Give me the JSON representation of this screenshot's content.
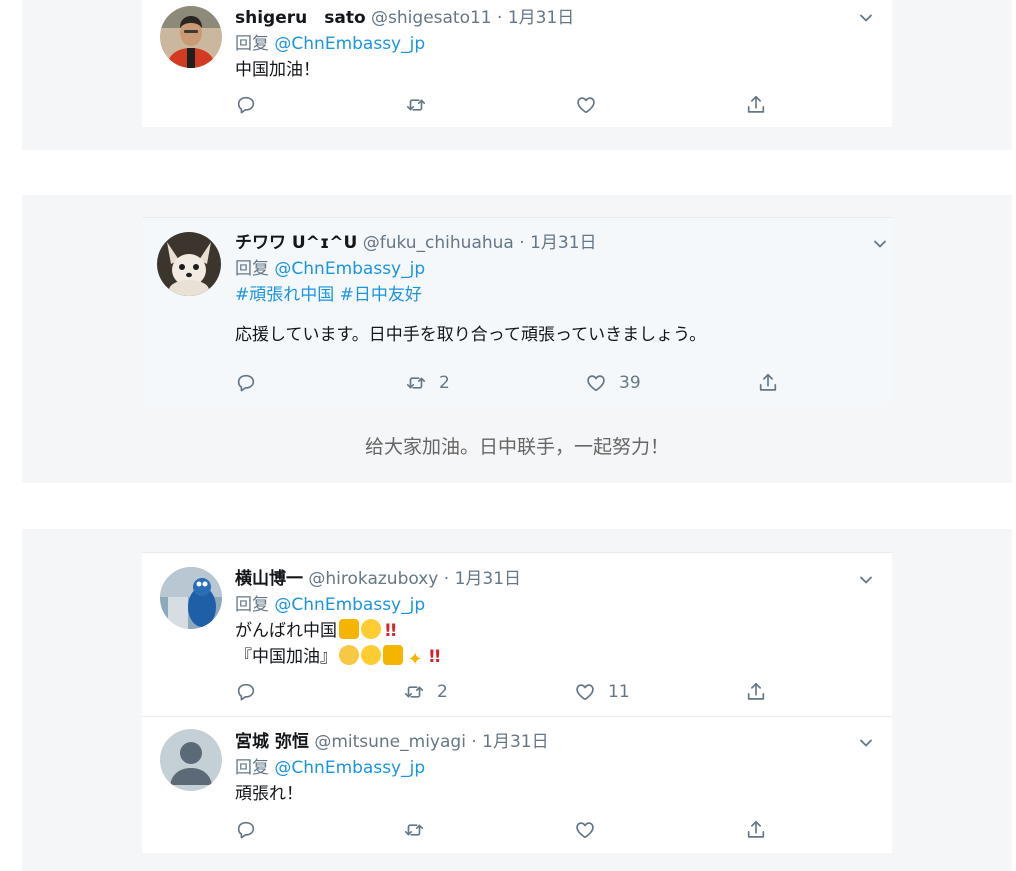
{
  "tweets": [
    {
      "name": "shigeru　sato",
      "handle": "@shigesato11",
      "date": "1月31日",
      "reply_prefix": "回复",
      "reply_to": "@ChnEmbassy_jp",
      "text": "中国加油！",
      "replies": "",
      "retweets": "",
      "likes": ""
    },
    {
      "name": "チワワ U^ɪ^U",
      "handle": "@fuku_chihuahua",
      "date": "1月31日",
      "reply_prefix": "回复",
      "reply_to": "@ChnEmbassy_jp",
      "hashtags": "#頑張れ中国 #日中友好",
      "text": "応援しています。日中手を取り合って頑張っていきましょう。",
      "replies": "",
      "retweets": "2",
      "likes": "39"
    },
    {
      "name": "横山博一",
      "handle": "@hirokazuboxy",
      "date": "1月31日",
      "reply_prefix": "回复",
      "reply_to": "@ChnEmbassy_jp",
      "text_line1": "がんばれ中国",
      "text_line2": "『中国加油』",
      "emoji_line1": [
        "fist-emoji",
        "laughing-emoji",
        "double-exclamation"
      ],
      "emoji_line2": [
        "raised-fist-emoji",
        "grin-emoji",
        "thumbs-up-emoji",
        "sparkles-emoji",
        "double-exclamation"
      ],
      "replies": "",
      "retweets": "2",
      "likes": "11"
    },
    {
      "name": "宮城 弥恒",
      "handle": "@mitsune_miyagi",
      "date": "1月31日",
      "reply_prefix": "回复",
      "reply_to": "@ChnEmbassy_jp",
      "text": "頑張れ！",
      "replies": "",
      "retweets": "",
      "likes": ""
    }
  ],
  "separator": " · ",
  "caption": "给大家加油。日中联手，一起努力！",
  "double_exclamation": "!!",
  "colors": {
    "link": "#1b95e0",
    "muted": "#657786",
    "panel": "#f5f6f7",
    "highlight": "#f5f8fa"
  },
  "icons": [
    "reply-icon",
    "retweet-icon",
    "like-icon",
    "share-icon",
    "chevron-down-icon"
  ]
}
